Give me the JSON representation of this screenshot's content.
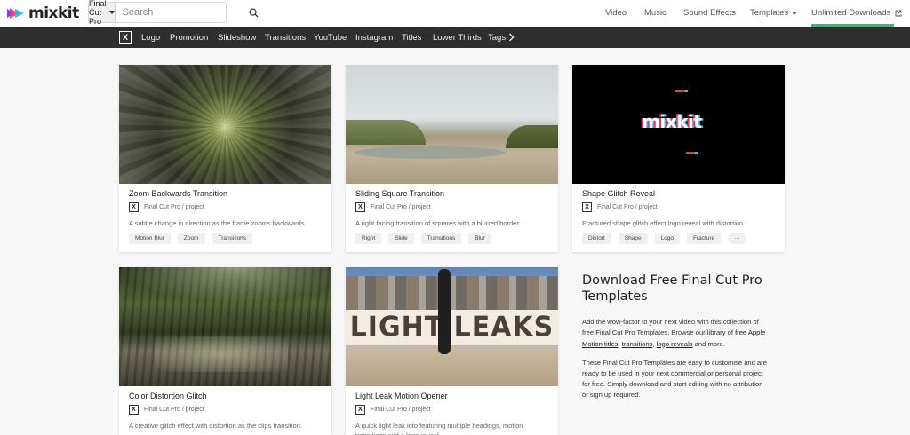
{
  "brand": {
    "name": "mixkit"
  },
  "search": {
    "category": "Final Cut Pro",
    "placeholder": "Search"
  },
  "nav": {
    "video": "Video",
    "music": "Music",
    "sound_effects": "Sound Effects",
    "templates": "Templates",
    "unlimited": "Unlimited Downloads"
  },
  "categories": {
    "x_label": "X",
    "items": [
      "Logo",
      "Promotion",
      "Slideshow",
      "Transitions",
      "YouTube",
      "Instagram",
      "Titles",
      "Lower Thirds",
      "Tags"
    ]
  },
  "cards": [
    {
      "title": "Zoom Backwards Transition",
      "meta": "Final Cut Pro / project",
      "desc": "A subtle change in direction as the frame zooms backwards.",
      "tags": [
        "Motion Blur",
        "Zoom",
        "Transitions"
      ]
    },
    {
      "title": "Sliding Square Transition",
      "meta": "Final Cut Pro / project",
      "desc": "A right facing transition of squares with a blurred border.",
      "tags": [
        "Right",
        "Slide",
        "Transitions",
        "Blur"
      ]
    },
    {
      "title": "Shape Glitch Reveal",
      "meta": "Final Cut Pro / project",
      "desc": "Fractured shape glitch effect logo reveal with distortion.",
      "tags": [
        "Distort",
        "Shape",
        "Logo",
        "Fracture",
        "···"
      ],
      "thumb_text": "mixkit"
    },
    {
      "title": "Color Distortion Glitch",
      "meta": "Final Cut Pro / project",
      "desc": "A creative glitch effect with distortion as the clips transition."
    },
    {
      "title": "Light Leak Motion Opener",
      "meta": "Final Cut Pro / project",
      "desc": "A quick light leak into featuring multiple headings, motion transitions and a logo reveal.",
      "thumb_text": "LIGHT LEAKS"
    }
  ],
  "side": {
    "title": "Download Free Final Cut Pro Templates",
    "p1_a": "Add the wow-factor to your next video with this collection of free Final Cut Pro Templates. Browse our library of ",
    "link1": "free Apple Motion titles",
    "p1_b": ", ",
    "link2": "transitions",
    "p1_c": ", ",
    "link3": "logo reveals",
    "p1_d": " and more.",
    "p2": "These Final Cut Pro Templates are easy to customise and are ready to be used in your next commercial or personal project for free. Simply download and start editing with no attribution or sign up required."
  },
  "colors": {
    "accent": "#27c36a",
    "catbar": "#2e2e2e"
  }
}
